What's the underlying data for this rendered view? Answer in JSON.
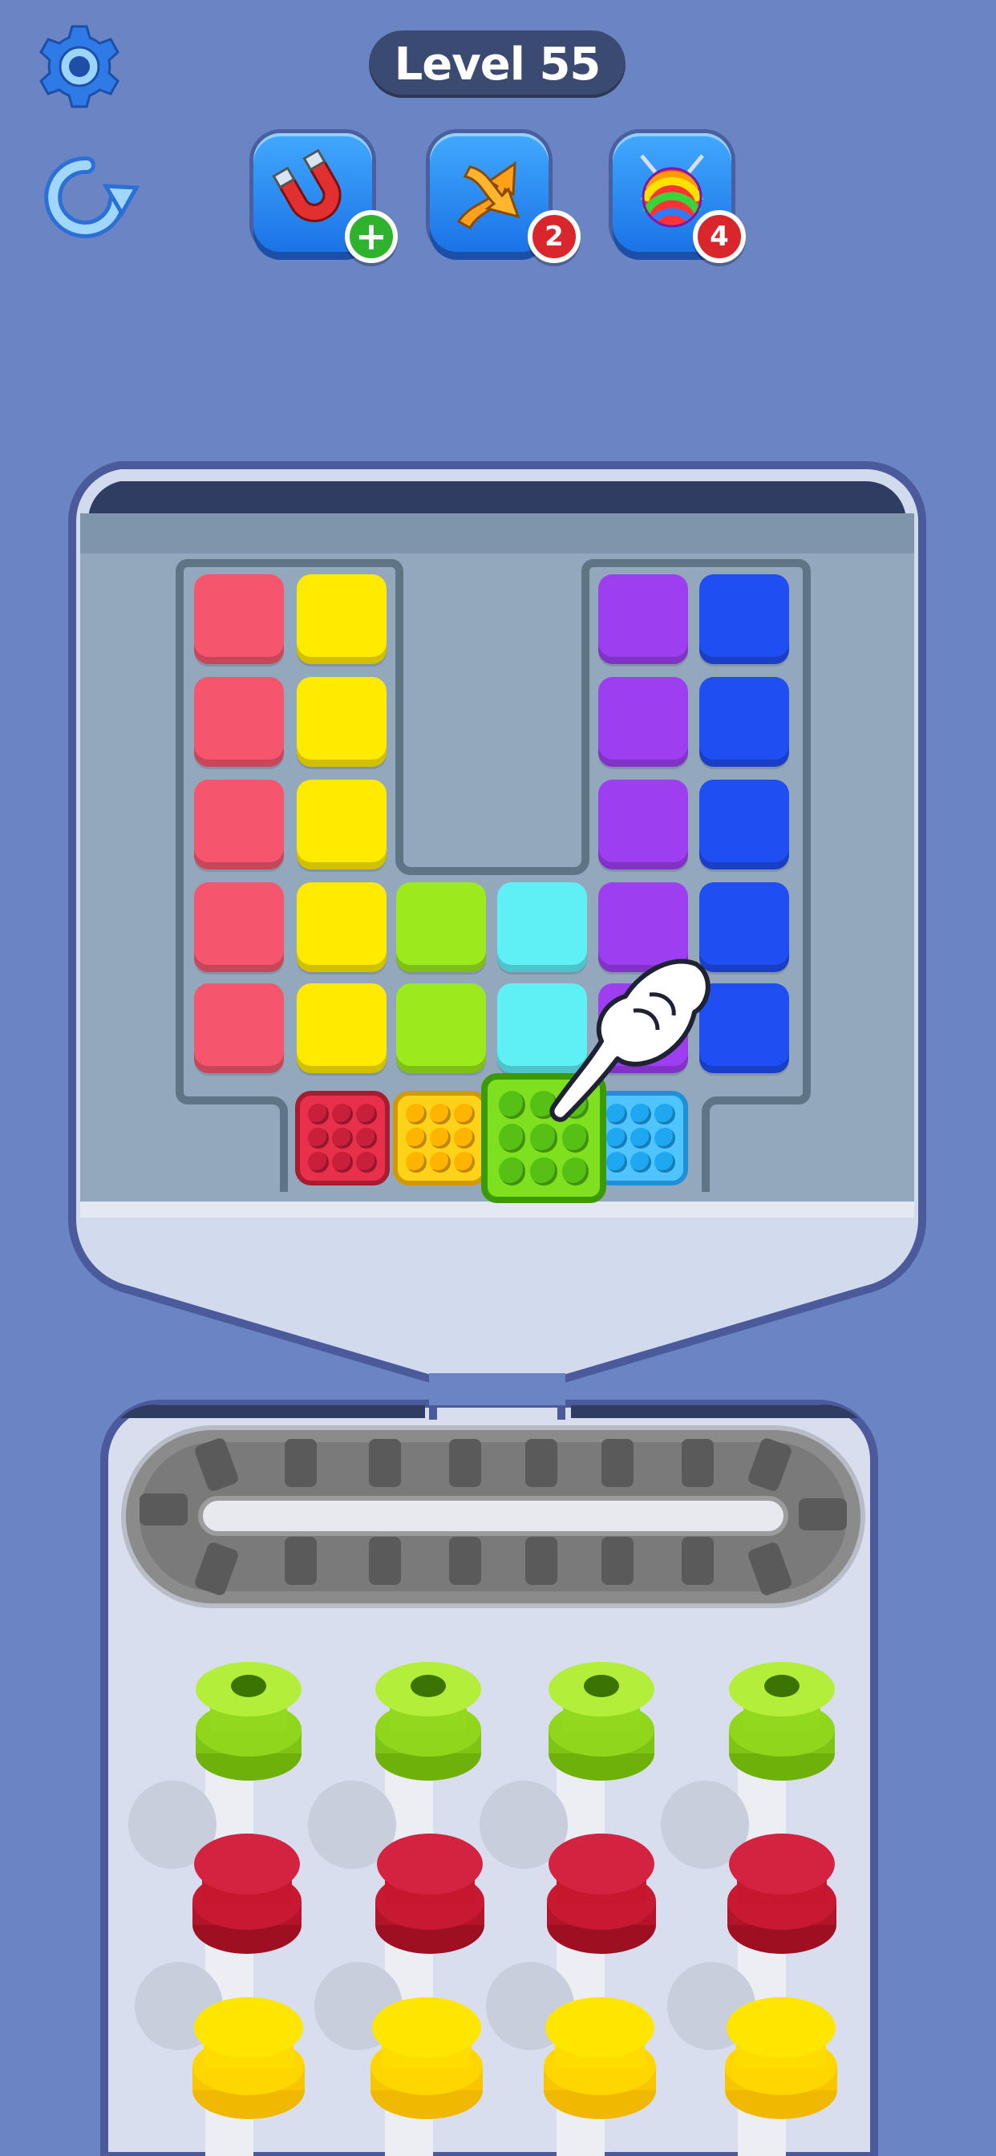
{
  "level": {
    "label": "Level 55"
  },
  "boosters": [
    {
      "icon": "magnet-icon",
      "badge": "+",
      "badge_color": "#2fb32f"
    },
    {
      "icon": "shuffle-arrows-icon",
      "badge": "2",
      "badge_color": "#d8262c"
    },
    {
      "icon": "yarn-ball-icon",
      "badge": "4",
      "badge_color": "#d8262c"
    }
  ],
  "colors": {
    "background": "#6a84c4",
    "pink": "#f5566d",
    "yellow": "#ffea00",
    "lime": "#9bea1e",
    "cyan": "#5ff0f6",
    "purple": "#9d3ff0",
    "blue": "#1f4ef2"
  },
  "board": {
    "columns": [
      {
        "color": "pink",
        "count": 5
      },
      {
        "color": "yellow",
        "count": 5
      },
      {
        "color": "lime",
        "count": 2
      },
      {
        "color": "cyan",
        "count": 2
      },
      {
        "color": "purple",
        "count": 5
      },
      {
        "color": "blue",
        "count": 5
      }
    ],
    "yarn_boxes": [
      "red",
      "yellow",
      "green",
      "blue"
    ],
    "selected_yarn_box": "green"
  },
  "spool_rows": [
    "lime",
    "crimson",
    "yellow"
  ],
  "hint": {
    "icon": "pointing-hand-icon"
  }
}
